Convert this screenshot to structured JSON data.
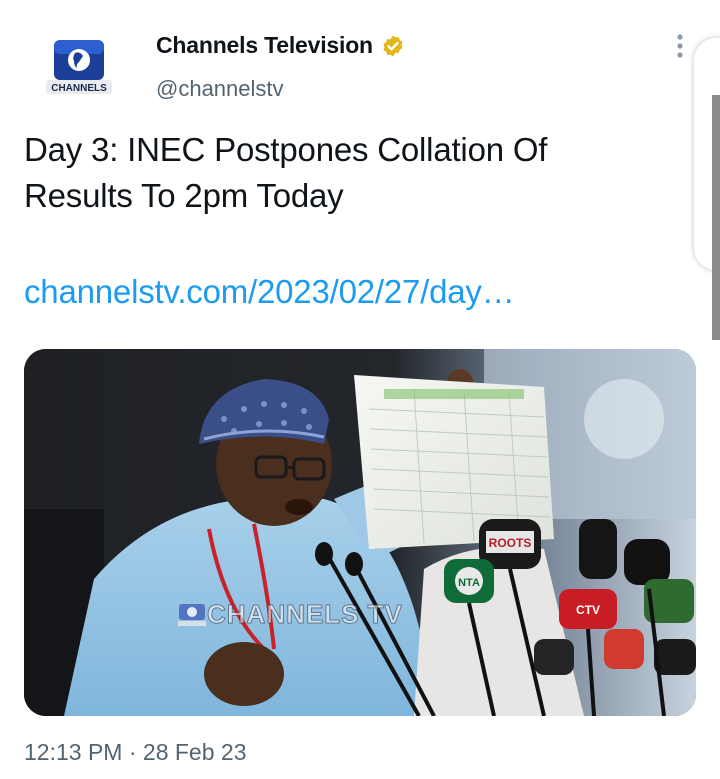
{
  "tweet": {
    "author": {
      "display_name": "Channels Television",
      "handle": "@channelstv",
      "avatar_label": "CHANNELS",
      "verified": true,
      "badge_color": "#e2b719"
    },
    "text": "Day 3: INEC Postpones Collation Of Results To 2pm Today",
    "link": "channelstv.com/2023/02/27/day…",
    "media": {
      "watermark": "CHANNELS TV",
      "microphone_labels": [
        "ROOTS",
        "NTA",
        "CTV"
      ]
    },
    "time": "12:13 PM",
    "separator": "·",
    "date": "28 Feb 23"
  },
  "colors": {
    "text": "#0f1419",
    "secondary": "#536471",
    "link": "#1d9bf0"
  },
  "icons": {
    "more": "more-vertical-icon",
    "verified": "verified-badge-icon",
    "avatar": "channels-logo-icon"
  }
}
